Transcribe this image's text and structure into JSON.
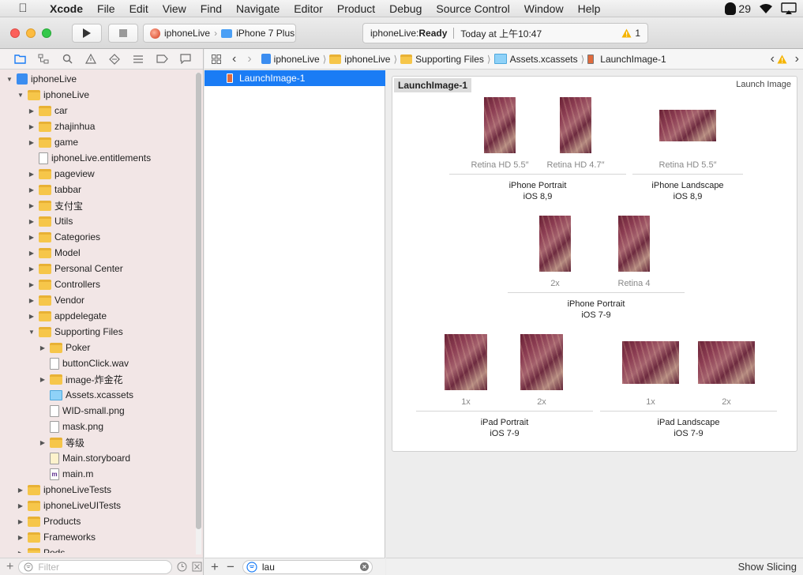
{
  "menubar": {
    "app": "Xcode",
    "items": [
      "File",
      "Edit",
      "View",
      "Find",
      "Navigate",
      "Editor",
      "Product",
      "Debug",
      "Source Control",
      "Window",
      "Help"
    ],
    "qq_count": "29"
  },
  "toolbar": {
    "scheme": "iphoneLive",
    "device": "iPhone 7 Plus",
    "activity_project": "iphoneLive: ",
    "activity_status": "Ready",
    "activity_time": "Today at 上午10:47",
    "warning_count": "1"
  },
  "navigator": {
    "tree": [
      {
        "label": "iphoneLive",
        "level": 0,
        "kind": "project",
        "expanded": true
      },
      {
        "label": "iphoneLive",
        "level": 1,
        "kind": "folder",
        "expanded": true
      },
      {
        "label": "car",
        "level": 2,
        "kind": "folder",
        "expanded": false
      },
      {
        "label": "zhajinhua",
        "level": 2,
        "kind": "folder",
        "expanded": false
      },
      {
        "label": "game",
        "level": 2,
        "kind": "folder",
        "expanded": false
      },
      {
        "label": "iphoneLive.entitlements",
        "level": 2,
        "kind": "file"
      },
      {
        "label": "pageview",
        "level": 2,
        "kind": "folder",
        "expanded": false
      },
      {
        "label": "tabbar",
        "level": 2,
        "kind": "folder",
        "expanded": false
      },
      {
        "label": "支付宝",
        "level": 2,
        "kind": "folder",
        "expanded": false
      },
      {
        "label": "Utils",
        "level": 2,
        "kind": "folder",
        "expanded": false
      },
      {
        "label": "Categories",
        "level": 2,
        "kind": "folder",
        "expanded": false
      },
      {
        "label": "Model",
        "level": 2,
        "kind": "folder",
        "expanded": false
      },
      {
        "label": "Personal Center",
        "level": 2,
        "kind": "folder",
        "expanded": false
      },
      {
        "label": "Controllers",
        "level": 2,
        "kind": "folder",
        "expanded": false
      },
      {
        "label": "Vendor",
        "level": 2,
        "kind": "folder",
        "expanded": false
      },
      {
        "label": "appdelegate",
        "level": 2,
        "kind": "folder",
        "expanded": false
      },
      {
        "label": "Supporting Files",
        "level": 2,
        "kind": "folder",
        "expanded": true
      },
      {
        "label": "Poker",
        "level": 3,
        "kind": "folder",
        "expanded": false
      },
      {
        "label": "buttonClick.wav",
        "level": 3,
        "kind": "file"
      },
      {
        "label": "image-炸金花",
        "level": 3,
        "kind": "folder",
        "expanded": false
      },
      {
        "label": "Assets.xcassets",
        "level": 3,
        "kind": "xcassets"
      },
      {
        "label": "WID-small.png",
        "level": 3,
        "kind": "file"
      },
      {
        "label": "mask.png",
        "level": 3,
        "kind": "file"
      },
      {
        "label": "等级",
        "level": 3,
        "kind": "folder",
        "expanded": false
      },
      {
        "label": "Main.storyboard",
        "level": 3,
        "kind": "storyboard"
      },
      {
        "label": "main.m",
        "level": 3,
        "kind": "m"
      },
      {
        "label": "iphoneLiveTests",
        "level": 1,
        "kind": "folder",
        "expanded": false
      },
      {
        "label": "iphoneLiveUITests",
        "level": 1,
        "kind": "folder",
        "expanded": false
      },
      {
        "label": "Products",
        "level": 1,
        "kind": "folder",
        "expanded": false
      },
      {
        "label": "Frameworks",
        "level": 1,
        "kind": "folder",
        "expanded": false
      },
      {
        "label": "Pods",
        "level": 1,
        "kind": "folder",
        "expanded": false
      }
    ],
    "filter_placeholder": "Filter"
  },
  "jumpbar": {
    "crumbs": [
      "iphoneLive",
      "iphoneLive",
      "Supporting Files",
      "Assets.xcassets",
      "LaunchImage-1"
    ]
  },
  "asset_list": {
    "selected": "LaunchImage-1",
    "search_value": "lau"
  },
  "editor": {
    "set_name": "LaunchImage-1",
    "set_type": "Launch Image",
    "slots": {
      "iphone_portrait_89_a": "Retina HD 5.5″",
      "iphone_portrait_89_b": "Retina HD 4.7″",
      "iphone_landscape_89": "Retina HD 5.5″",
      "iphone_portrait_79_a": "2x",
      "iphone_portrait_79_b": "Retina 4",
      "ipad_portrait_a": "1x",
      "ipad_portrait_b": "2x",
      "ipad_landscape_a": "1x",
      "ipad_landscape_b": "2x"
    },
    "groups": {
      "iphone_portrait_89": {
        "device": "iPhone Portrait",
        "os": "iOS 8,9"
      },
      "iphone_landscape_89": {
        "device": "iPhone Landscape",
        "os": "iOS 8,9"
      },
      "iphone_portrait_79": {
        "device": "iPhone Portrait",
        "os": "iOS 7-9"
      },
      "ipad_portrait": {
        "device": "iPad Portrait",
        "os": "iOS 7-9"
      },
      "ipad_landscape": {
        "device": "iPad Landscape",
        "os": "iOS 7-9"
      }
    },
    "show_slicing": "Show Slicing"
  },
  "colors": {
    "accent": "#1a7cf5",
    "navigator_bg": "#f2e6e6",
    "folder": "#f6c64a",
    "warning": "#f5b400"
  }
}
